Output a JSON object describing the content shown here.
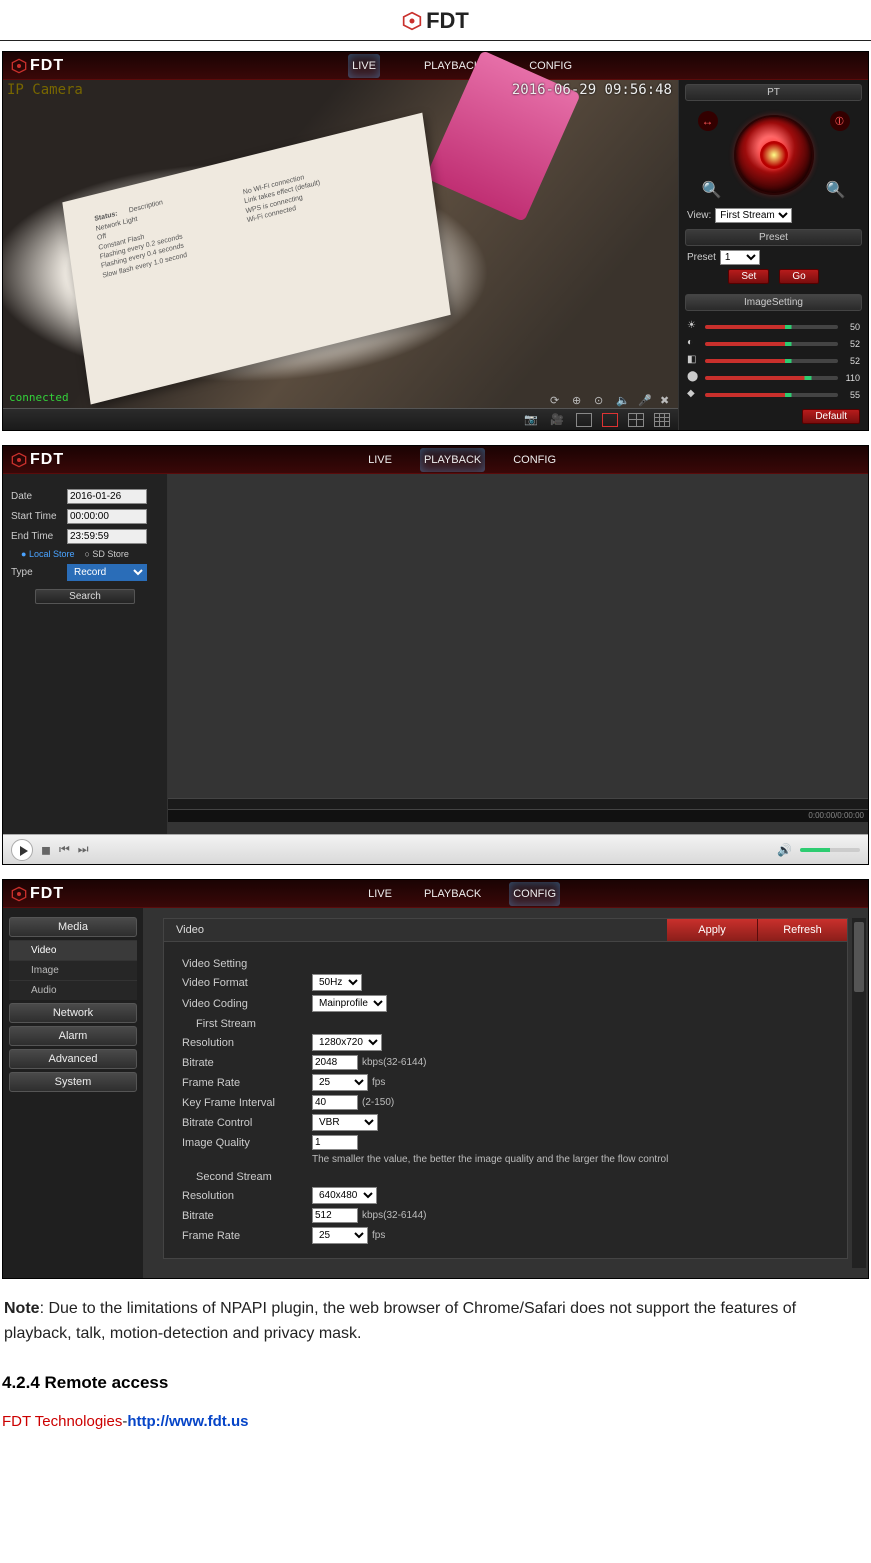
{
  "brand": "FDT",
  "nav": {
    "live": "LIVE",
    "playback": "PLAYBACK",
    "config": "CONFIG"
  },
  "live": {
    "overlay_label": "IP Camera",
    "timestamp": "2016-06-29 09:56:48",
    "connected": "connected",
    "paper_heading": "Status:",
    "paper_cols": "Description",
    "paper_lines": "Network Light\nOff\nConstant Flash\nFlashing every 0.2 seconds\nFlashing every 0.4 seconds\nSlow flash every 1.0 second",
    "paper_lines2": "No Wi-Fi connection\nLink takes effect (default)\nWPS is connecting\nWi-Fi connected",
    "pt_header": "PT",
    "view_label": "View:",
    "view_value": "First Stream",
    "preset_header": "Preset",
    "preset_label": "Preset",
    "preset_value": "1",
    "set_btn": "Set",
    "go_btn": "Go",
    "imageset_header": "ImageSetting",
    "sliders": [
      {
        "icon": "sun",
        "val": "50"
      },
      {
        "icon": "contrast",
        "val": "52"
      },
      {
        "icon": "hue",
        "val": "52"
      },
      {
        "icon": "sat",
        "val": "110"
      },
      {
        "icon": "sharp",
        "val": "55"
      }
    ],
    "default_btn": "Default"
  },
  "playback": {
    "date_label": "Date",
    "date_value": "2016-01-26",
    "start_label": "Start Time",
    "start_value": "00:00:00",
    "end_label": "End Time",
    "end_value": "23:59:59",
    "store_local": "Local Store",
    "store_sd": "SD Store",
    "type_label": "Type",
    "type_value": "Record",
    "search_btn": "Search",
    "time_readout": "0:00:00/0:00:00"
  },
  "config": {
    "nav_media": "Media",
    "nav_video": "Video",
    "nav_image": "Image",
    "nav_audio": "Audio",
    "nav_network": "Network",
    "nav_alarm": "Alarm",
    "nav_advanced": "Advanced",
    "nav_system": "System",
    "panel_title": "Video",
    "apply": "Apply",
    "refresh": "Refresh",
    "section_videosetting": "Video Setting",
    "video_format_label": "Video Format",
    "video_format_value": "50Hz",
    "video_coding_label": "Video Coding",
    "video_coding_value": "Mainprofile",
    "section_first": "First Stream",
    "res1_label": "Resolution",
    "res1_value": "1280x720",
    "bitrate1_label": "Bitrate",
    "bitrate1_value": "2048",
    "bitrate_hint": "kbps(32-6144)",
    "fr1_label": "Frame Rate",
    "fr1_value": "25",
    "fr_hint": "fps",
    "kfi_label": "Key Frame Interval",
    "kfi_value": "40",
    "kfi_hint": "(2-150)",
    "brc_label": "Bitrate Control",
    "brc_value": "VBR",
    "iq_label": "Image Quality",
    "iq_value": "1",
    "iq_note": "The smaller the value, the better the image quality and the larger the flow control",
    "section_second": "Second Stream",
    "res2_label": "Resolution",
    "res2_value": "640x480",
    "bitrate2_label": "Bitrate",
    "bitrate2_value": "512",
    "fr2_label": "Frame Rate",
    "fr2_value": "25"
  },
  "doc": {
    "note_label": "Note",
    "note_body": ": Due to the limitations of NPAPI plugin, the web browser of Chrome/Safari does not support the features of playback, talk, motion-detection and privacy mask.",
    "section_num": "4.2.4 Remote access",
    "footer_company": "FDT Technologies",
    "footer_dash": "-",
    "footer_url": "http://www.fdt.us"
  }
}
